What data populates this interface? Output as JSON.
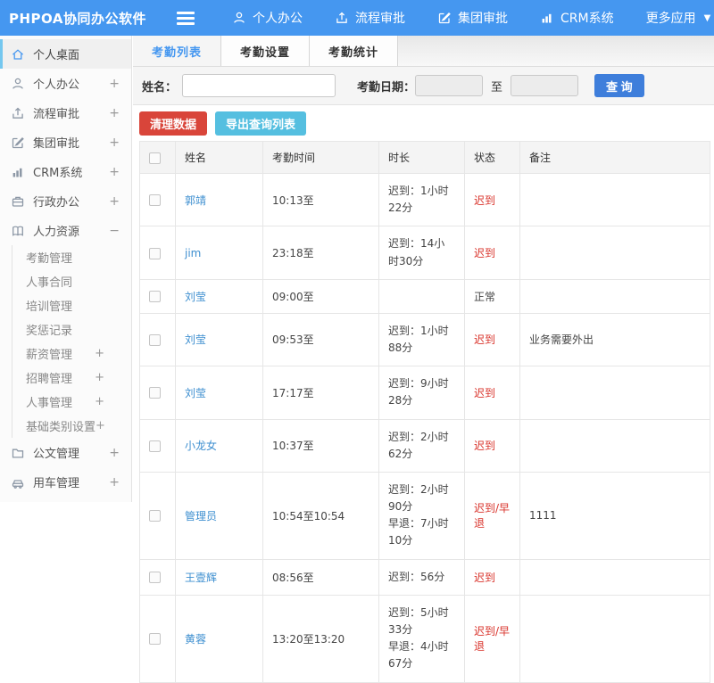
{
  "topbar": {
    "logo": "PHPOA协同办公软件",
    "nav": [
      {
        "label": "个人办公",
        "icon": "user-icon"
      },
      {
        "label": "流程审批",
        "icon": "flow-icon"
      },
      {
        "label": "集团审批",
        "icon": "edit-icon"
      },
      {
        "label": "CRM系统",
        "icon": "bar-chart-icon"
      },
      {
        "label": "更多应用",
        "icon": "caret-down-icon"
      }
    ]
  },
  "sidebar": {
    "items": [
      {
        "label": "个人桌面",
        "icon": "home-icon",
        "expand": "",
        "active": true
      },
      {
        "label": "个人办公",
        "icon": "user-icon",
        "expand": "+"
      },
      {
        "label": "流程审批",
        "icon": "flow-icon",
        "expand": "+"
      },
      {
        "label": "集团审批",
        "icon": "edit-icon",
        "expand": "+"
      },
      {
        "label": "CRM系统",
        "icon": "bar-chart-icon",
        "expand": "+"
      },
      {
        "label": "行政办公",
        "icon": "briefcase-icon",
        "expand": "+"
      },
      {
        "label": "人力资源",
        "icon": "book-icon",
        "expand": "−",
        "children": [
          {
            "label": "考勤管理",
            "expand": ""
          },
          {
            "label": "人事合同",
            "expand": ""
          },
          {
            "label": "培训管理",
            "expand": ""
          },
          {
            "label": "奖惩记录",
            "expand": ""
          },
          {
            "label": "薪资管理",
            "expand": "+"
          },
          {
            "label": "招聘管理",
            "expand": "+"
          },
          {
            "label": "人事管理",
            "expand": "+"
          },
          {
            "label": "基础类别设置",
            "expand": "+"
          }
        ]
      },
      {
        "label": "公文管理",
        "icon": "folder-icon",
        "expand": "+"
      },
      {
        "label": "用车管理",
        "icon": "car-icon",
        "expand": "+"
      }
    ]
  },
  "tabs": {
    "items": [
      "考勤列表",
      "考勤设置",
      "考勤统计"
    ],
    "active_index": 0
  },
  "filter": {
    "name_label": "姓名：",
    "name_value": "",
    "date_label": "考勤日期：",
    "date_from": "",
    "to_label": "至",
    "date_to": "",
    "search_button": "查 询"
  },
  "toolbar": {
    "clean_button": "清理数据",
    "export_button": "导出查询列表"
  },
  "table": {
    "headers": [
      "姓名",
      "考勤时间",
      "时长",
      "状态",
      "备注"
    ],
    "rows": [
      {
        "name": "郭靖",
        "time": "10:13至",
        "duration": [
          "迟到：1小时22分"
        ],
        "status": "迟到",
        "abnormal": true,
        "remark": ""
      },
      {
        "name": "jim",
        "time": "23:18至",
        "duration": [
          "迟到：14小时30分"
        ],
        "status": "迟到",
        "abnormal": true,
        "remark": ""
      },
      {
        "name": "刘莹",
        "time": "09:00至",
        "duration": [],
        "status": "正常",
        "abnormal": false,
        "remark": ""
      },
      {
        "name": "刘莹",
        "time": "09:53至",
        "duration": [
          "迟到：1小时88分"
        ],
        "status": "迟到",
        "abnormal": true,
        "remark": "业务需要外出"
      },
      {
        "name": "刘莹",
        "time": "17:17至",
        "duration": [
          "迟到：9小时28分"
        ],
        "status": "迟到",
        "abnormal": true,
        "remark": ""
      },
      {
        "name": "小龙女",
        "time": "10:37至",
        "duration": [
          "迟到：2小时62分"
        ],
        "status": "迟到",
        "abnormal": true,
        "remark": ""
      },
      {
        "name": "管理员",
        "time": "10:54至10:54",
        "duration": [
          "迟到：2小时90分",
          "早退：7小时10分"
        ],
        "status": "迟到/早退",
        "abnormal": true,
        "remark": "1111"
      },
      {
        "name": "王壹辉",
        "time": "08:56至",
        "duration": [
          "迟到：56分"
        ],
        "status": "迟到",
        "abnormal": true,
        "remark": ""
      },
      {
        "name": "黄蓉",
        "time": "13:20至13:20",
        "duration": [
          "迟到：5小时33分",
          "早退：4小时67分"
        ],
        "status": "迟到/早退",
        "abnormal": true,
        "remark": ""
      }
    ]
  },
  "colors": {
    "topbar_bg": "#4597f0",
    "accent_blue": "#4597f0",
    "search_button_blue": "#3e7edb",
    "clean_button_red": "#d9453a",
    "export_button_teal": "#55bfe0",
    "status_red": "#d9332b",
    "link_blue": "#3e8fd0",
    "active_item_border": "#74c7ef"
  }
}
